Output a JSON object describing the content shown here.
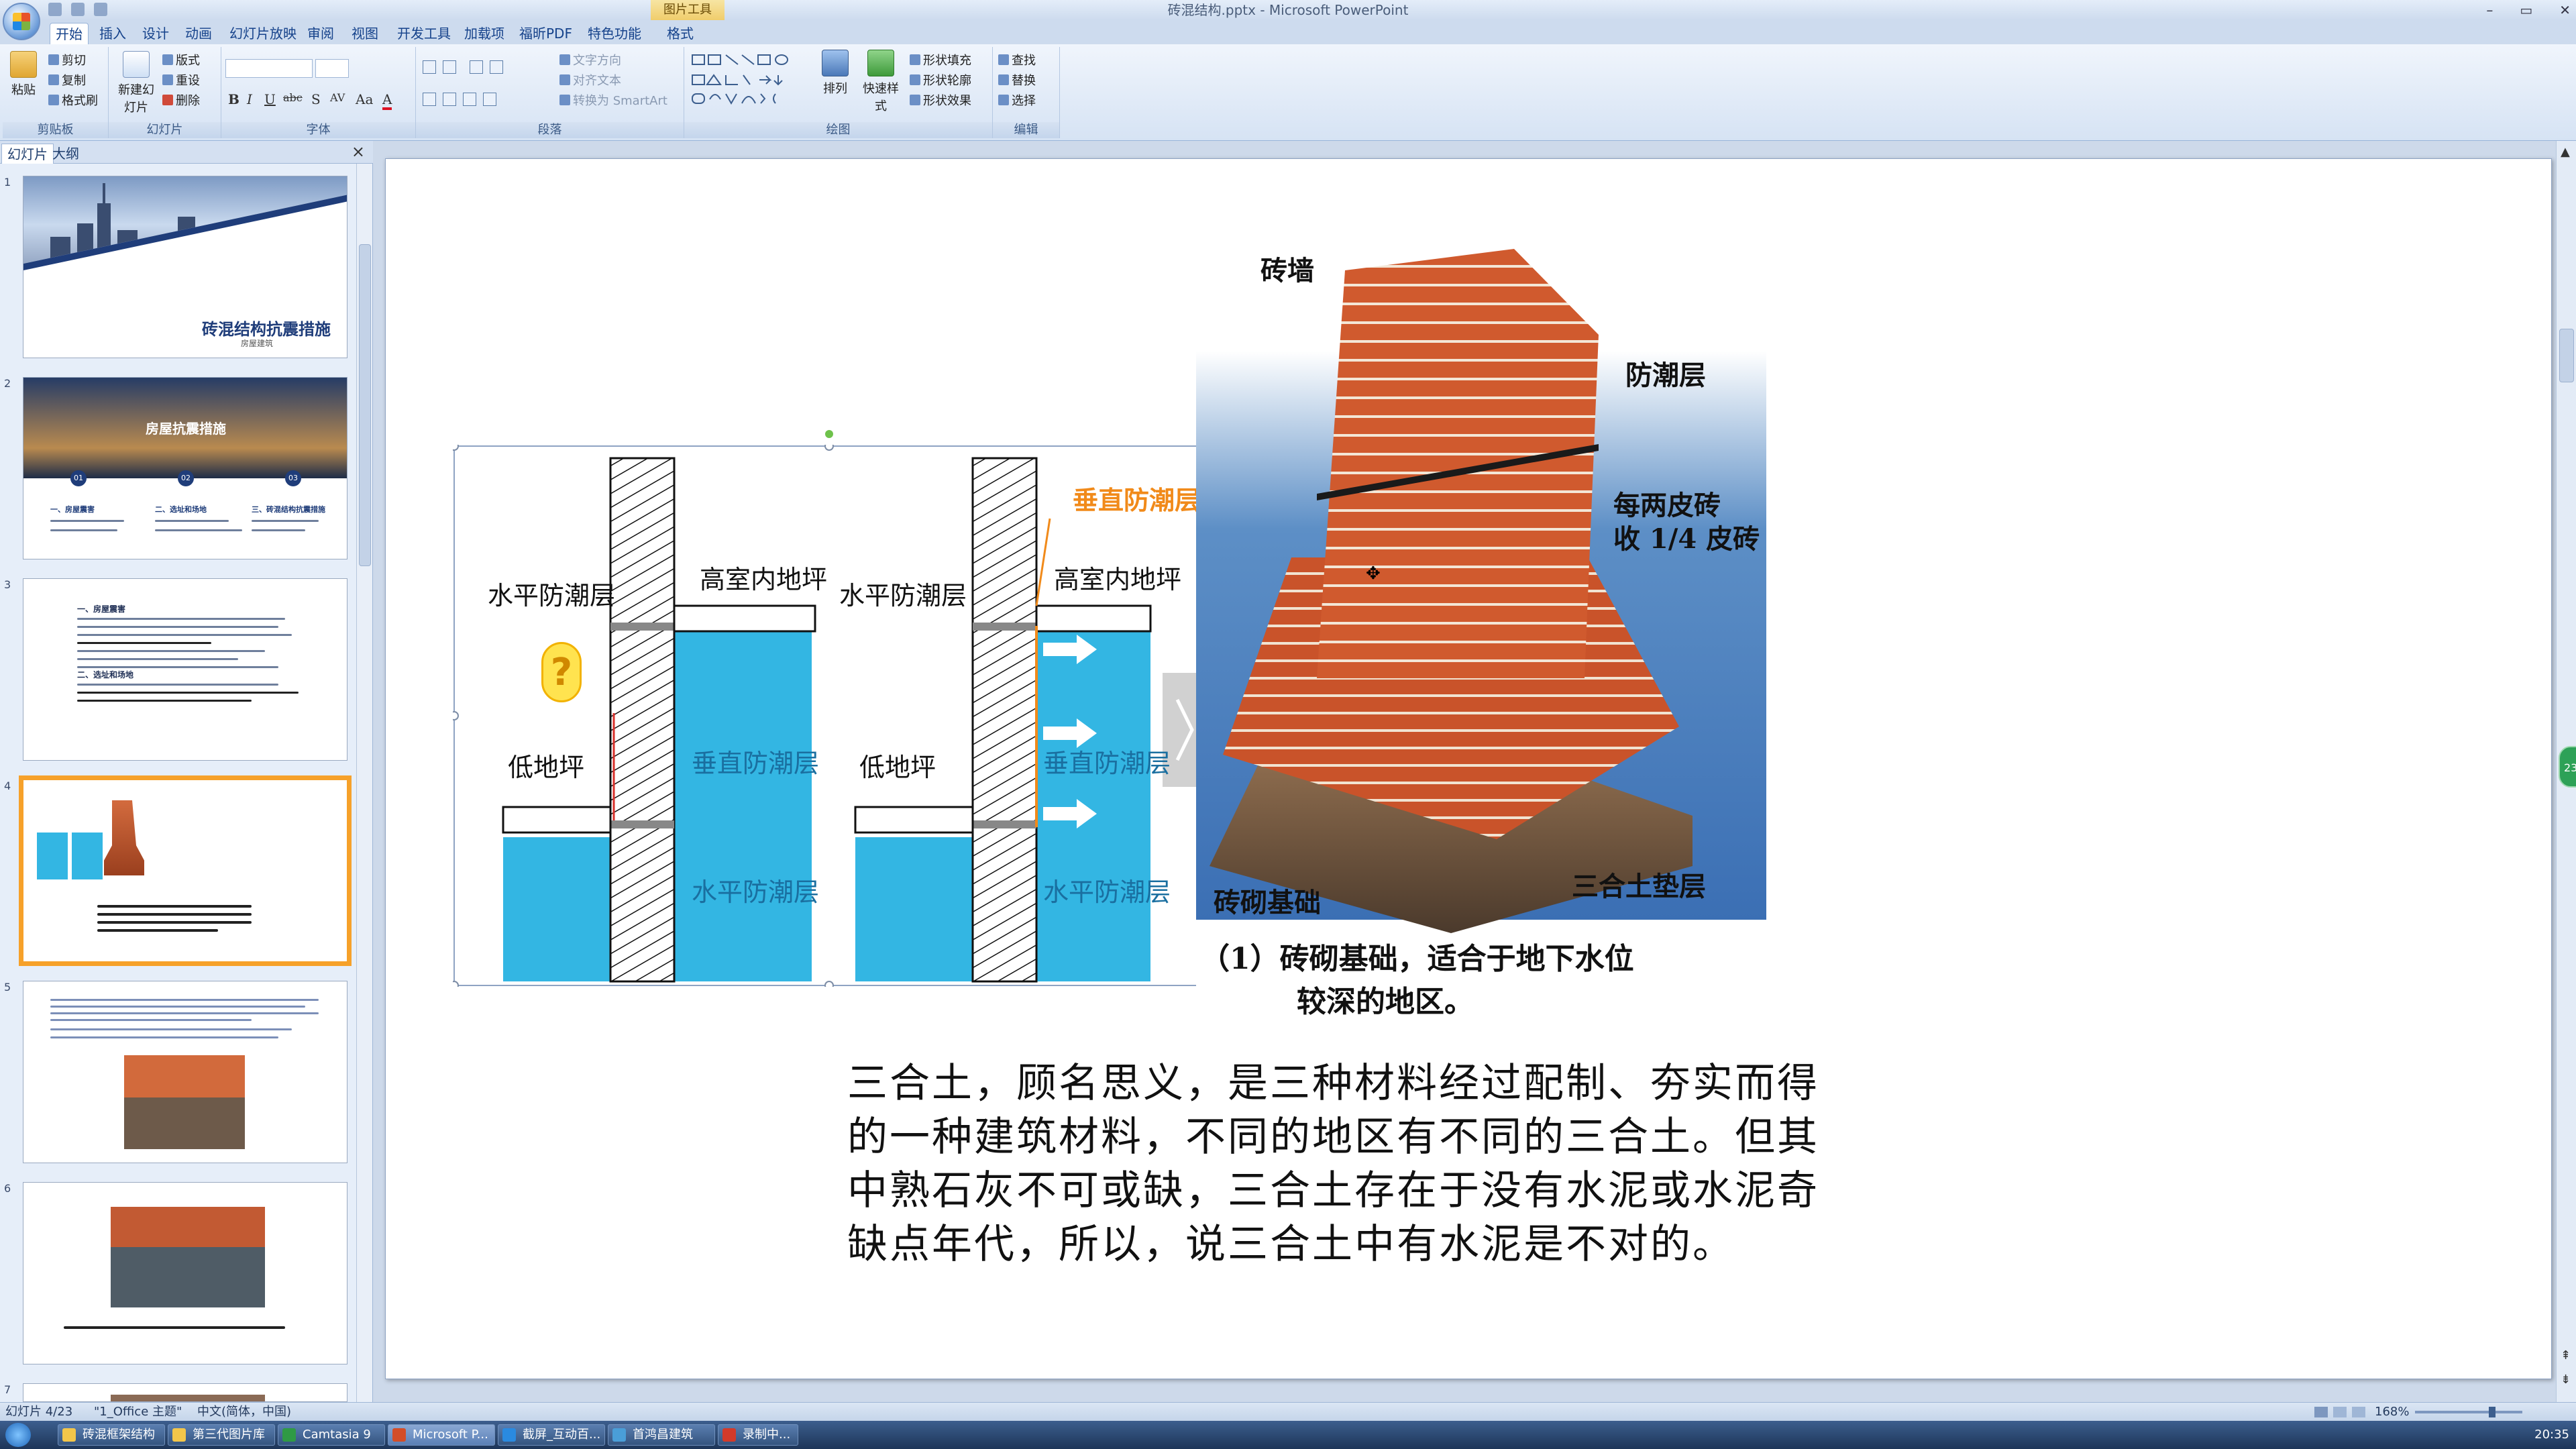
{
  "window": {
    "title": "砖混结构.pptx - Microsoft PowerPoint",
    "contextual_tab": "图片工具",
    "controls": [
      "–",
      "▭",
      "✕"
    ]
  },
  "ribbon_tabs": [
    "开始",
    "插入",
    "设计",
    "动画",
    "幻灯片放映",
    "审阅",
    "视图",
    "开发工具",
    "加载项",
    "福昕PDF",
    "特色功能",
    "格式"
  ],
  "ribbon": {
    "clipboard": {
      "paste": "粘贴",
      "cut": "剪切",
      "copy": "复制",
      "format_painter": "格式刷",
      "label": "剪贴板"
    },
    "slides": {
      "new_slide": "新建幻灯片",
      "layout": "版式",
      "reset": "重设",
      "delete": "删除",
      "label": "幻灯片"
    },
    "font": {
      "bold": "B",
      "italic": "I",
      "underline": "U",
      "strike": "abc",
      "shadow": "S",
      "spacing": "AV",
      "case": "Aa",
      "color": "A",
      "label": "字体"
    },
    "paragraph": {
      "text_direction": "文字方向",
      "align_text": "对齐文本",
      "smartart": "转换为 SmartArt",
      "label": "段落"
    },
    "drawing": {
      "arrange": "排列",
      "quick_styles": "快速样式",
      "shape_fill": "形状填充",
      "shape_outline": "形状轮廓",
      "shape_effects": "形状效果",
      "label": "绘图"
    },
    "editing": {
      "find": "查找",
      "replace": "替换",
      "select": "选择",
      "label": "编辑"
    }
  },
  "panel": {
    "tabs": [
      "幻灯片",
      "大纲"
    ],
    "close": "×",
    "thumbs": [
      {
        "num": "1",
        "title": "砖混结构抗震措施",
        "sub": "房屋建筑"
      },
      {
        "num": "2",
        "title": "房屋抗震措施",
        "items": [
          "一、房屋震害",
          "二、选址和场地",
          "三、砖混结构抗震措施"
        ],
        "badges": [
          "01",
          "02",
          "03"
        ]
      },
      {
        "num": "3",
        "heading": "一、房屋震害",
        "heading2": "二、选址和场地"
      },
      {
        "num": "4"
      },
      {
        "num": "5"
      },
      {
        "num": "6"
      },
      {
        "num": "7"
      }
    ]
  },
  "slide": {
    "caption_top_left_1": "水平防潮层",
    "caption_high_floor_1": "高室内地坪",
    "caption_low_floor_1": "低地坪",
    "caption_vertical_1": "垂直防潮层",
    "caption_horizontal_1": "水平防潮层",
    "caption_vertical_top_2": "垂直防潮层",
    "caption_top_left_2": "水平防潮层",
    "caption_high_floor_2": "高室内地坪",
    "caption_low_floor_2": "低地坪",
    "caption_vertical_2": "垂直防潮层",
    "caption_horizontal_2": "水平防潮层",
    "question_mark": "?",
    "brick_labels": {
      "wall": "砖墙",
      "damp": "防潮层",
      "step1": "每两皮砖",
      "step2": "收 1/4 皮砖",
      "cushion": "三合土垫层",
      "base": "砖砌基础",
      "caption1": "（1）砖砌基础，适合于地下水位",
      "caption2": "较深的地区。"
    },
    "body_lines": [
      "三合土，顾名思义，是三种材料经过配制、夯实而得",
      "的一种建筑材料，不同的地区有不同的三合土。但其",
      "中熟石灰不可或缺，三合土存在于没有水泥或水泥奇",
      "缺点年代，所以，说三合土中有水泥是不对的。"
    ]
  },
  "statusbar": {
    "slide_info": "幻灯片 4/23",
    "theme": "\"1_Office 主题\"",
    "language": "中文(简体，中国)",
    "zoom": "168%"
  },
  "taskbar": {
    "items": [
      "砖混框架结构",
      "第三代图片库",
      "Camtasia 9",
      "Microsoft P...",
      "截屏_互动百...",
      "首鸿昌建筑",
      "录制中..."
    ],
    "clock": "20:35"
  },
  "badge": "23",
  "colors": {
    "accent_blue": "#2f6fc0",
    "selection": "#f6a12a",
    "water": "#33b6e3",
    "brick": "#c9532a"
  }
}
